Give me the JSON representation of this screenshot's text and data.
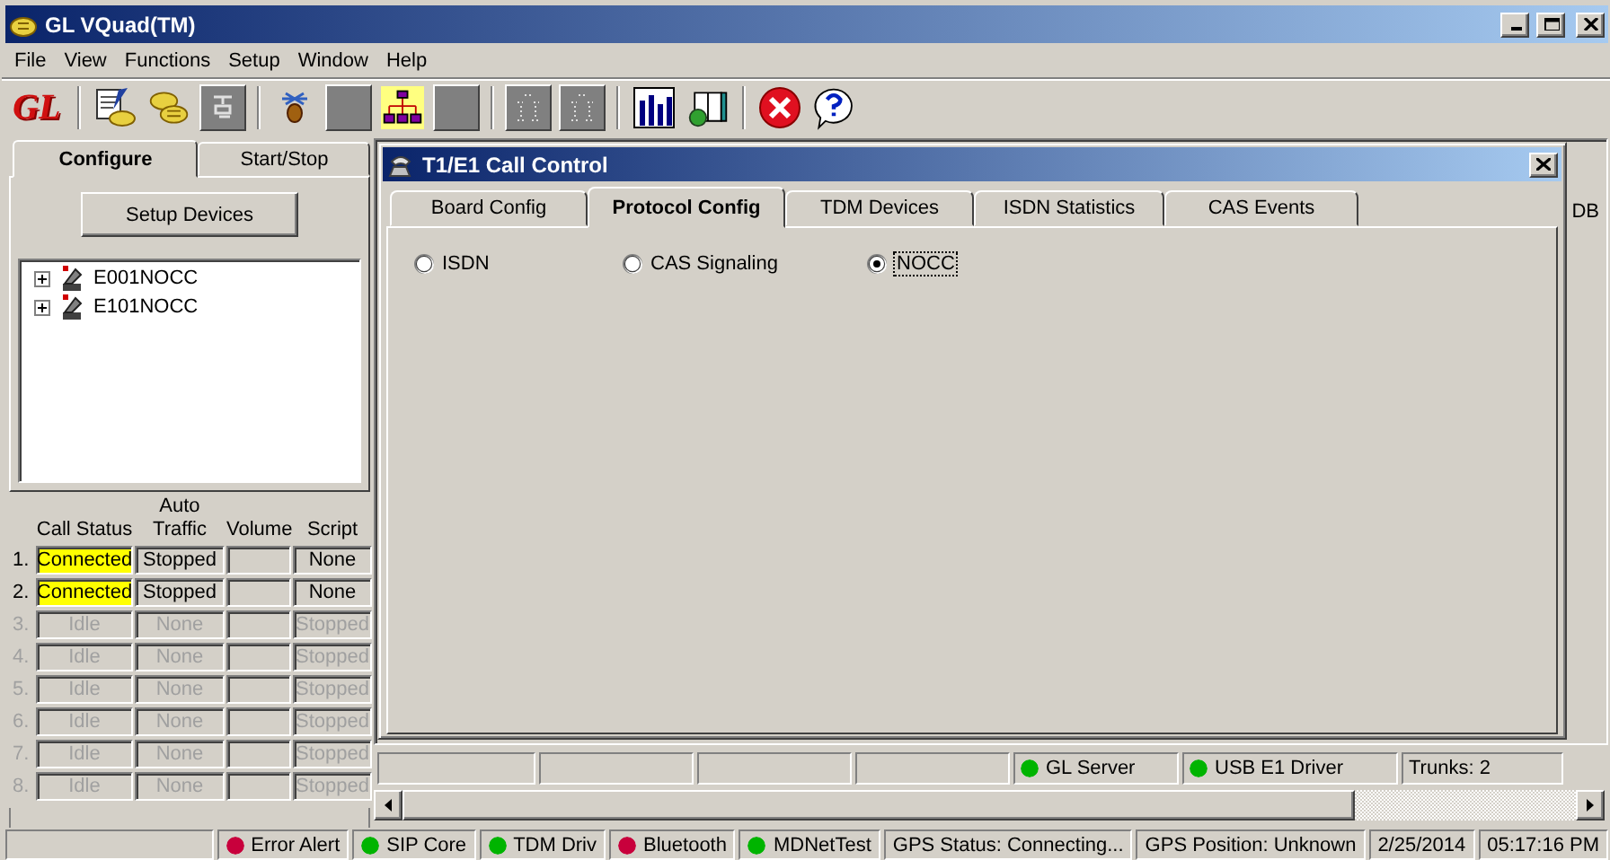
{
  "window": {
    "title": "GL VQuad(TM)"
  },
  "menu": [
    "File",
    "View",
    "Functions",
    "Setup",
    "Window",
    "Help"
  ],
  "toolbar": [
    {
      "kind": "logo",
      "label": "GL"
    },
    {
      "kind": "separator"
    },
    {
      "kind": "notepad",
      "disabled": false
    },
    {
      "kind": "phones",
      "disabled": false
    },
    {
      "kind": "handset",
      "disabled": true
    },
    {
      "kind": "separator"
    },
    {
      "kind": "bug",
      "disabled": false
    },
    {
      "kind": "blank",
      "disabled": true
    },
    {
      "kind": "network",
      "disabled": false
    },
    {
      "kind": "blank",
      "disabled": true
    },
    {
      "kind": "separator"
    },
    {
      "kind": "diagram",
      "disabled": true
    },
    {
      "kind": "diagram",
      "disabled": true
    },
    {
      "kind": "separator"
    },
    {
      "kind": "chart",
      "disabled": false
    },
    {
      "kind": "book",
      "disabled": false
    },
    {
      "kind": "separator"
    },
    {
      "kind": "stop",
      "disabled": false
    },
    {
      "kind": "help",
      "disabled": false
    }
  ],
  "left_panel": {
    "tabs": [
      {
        "label": "Configure",
        "selected": true
      },
      {
        "label": "Start/Stop",
        "selected": false
      }
    ],
    "setup_button": "Setup Devices",
    "tree": [
      {
        "label": "E001NOCC",
        "expanded": false
      },
      {
        "label": "E101NOCC",
        "expanded": false
      }
    ],
    "columns": [
      "Call Status",
      "Auto Traffic",
      "Volume",
      "Script"
    ],
    "rows": [
      {
        "index": "1.",
        "status": "Connected",
        "traffic": "Stopped",
        "script": "None",
        "highlighted": true,
        "disabled": false
      },
      {
        "index": "2.",
        "status": "Connected",
        "traffic": "Stopped",
        "script": "None",
        "highlighted": true,
        "disabled": false
      },
      {
        "index": "3.",
        "status": "Idle",
        "traffic": "None",
        "script": "Stopped",
        "highlighted": false,
        "disabled": true
      },
      {
        "index": "4.",
        "status": "Idle",
        "traffic": "None",
        "script": "Stopped",
        "highlighted": false,
        "disabled": true
      },
      {
        "index": "5.",
        "status": "Idle",
        "traffic": "None",
        "script": "Stopped",
        "highlighted": false,
        "disabled": true
      },
      {
        "index": "6.",
        "status": "Idle",
        "traffic": "None",
        "script": "Stopped",
        "highlighted": false,
        "disabled": true
      },
      {
        "index": "7.",
        "status": "Idle",
        "traffic": "None",
        "script": "Stopped",
        "highlighted": false,
        "disabled": true
      },
      {
        "index": "8.",
        "status": "Idle",
        "traffic": "None",
        "script": "Stopped",
        "highlighted": false,
        "disabled": true
      }
    ]
  },
  "call_window": {
    "title": "T1/E1 Call Control",
    "tabs": [
      {
        "label": "Board Config",
        "selected": false
      },
      {
        "label": "Protocol Config",
        "selected": true
      },
      {
        "label": "TDM Devices",
        "selected": false
      },
      {
        "label": "ISDN Statistics",
        "selected": false
      },
      {
        "label": "CAS Events",
        "selected": false
      }
    ],
    "radios": [
      {
        "label": "ISDN",
        "selected": false
      },
      {
        "label": "CAS Signaling",
        "selected": false
      },
      {
        "label": "NOCC",
        "selected": true
      }
    ]
  },
  "background_window": {
    "label": "DB"
  },
  "inner_status": [
    {
      "label": "GL Server",
      "color": "#00b400"
    },
    {
      "label": "USB E1 Driver",
      "color": "#00b400"
    },
    {
      "label": "Trunks: 2"
    }
  ],
  "status_bar": [
    {
      "label": "Error Alert",
      "color": "#c8003c"
    },
    {
      "label": "SIP Core",
      "color": "#00b400"
    },
    {
      "label": "TDM Driv",
      "color": "#00b400"
    },
    {
      "label": "Bluetooth",
      "color": "#c8003c"
    },
    {
      "label": "MDNetTest",
      "color": "#00b400"
    },
    {
      "label": "GPS Status: Connecting..."
    },
    {
      "label": "GPS Position: Unknown"
    },
    {
      "label": "2/25/2014"
    },
    {
      "label": "05:17:16 PM"
    }
  ]
}
